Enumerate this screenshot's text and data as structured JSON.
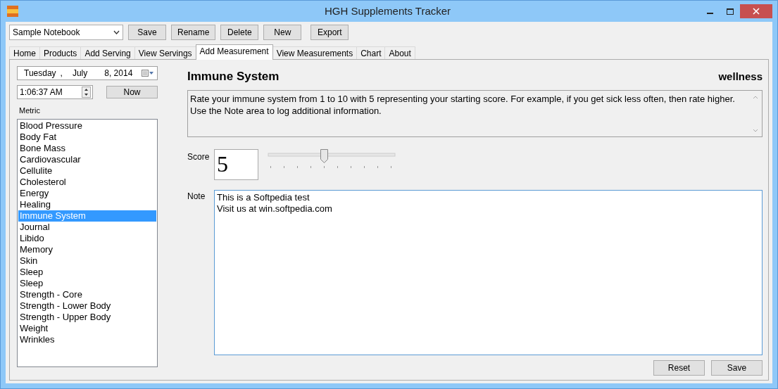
{
  "window": {
    "title": "HGH Supplements Tracker"
  },
  "notebook": {
    "value": "Sample Notebook"
  },
  "toolbar": [
    "Save",
    "Rename",
    "Delete",
    "New",
    "Export"
  ],
  "tabs": [
    {
      "label": "Home",
      "selected": false
    },
    {
      "label": "Products",
      "selected": false
    },
    {
      "label": "Add Serving",
      "selected": false
    },
    {
      "label": "View Servings",
      "selected": false
    },
    {
      "label": "Add Measurement",
      "selected": true
    },
    {
      "label": "View Measurements",
      "selected": false
    },
    {
      "label": "Chart",
      "selected": false
    },
    {
      "label": "About",
      "selected": false
    }
  ],
  "date": {
    "weekday": "Tuesday",
    "sep": ",",
    "month": "July",
    "day_year": "8, 2014"
  },
  "time": {
    "value": "1:06:37 AM"
  },
  "now_button": "Now",
  "metric_label": "Metric",
  "metrics": [
    {
      "label": "Blood Pressure",
      "selected": false
    },
    {
      "label": "Body Fat",
      "selected": false
    },
    {
      "label": "Bone Mass",
      "selected": false
    },
    {
      "label": "Cardiovascular",
      "selected": false
    },
    {
      "label": "Cellulite",
      "selected": false
    },
    {
      "label": "Cholesterol",
      "selected": false
    },
    {
      "label": "Energy",
      "selected": false
    },
    {
      "label": "Healing",
      "selected": false
    },
    {
      "label": "Immune System",
      "selected": true
    },
    {
      "label": "Journal",
      "selected": false
    },
    {
      "label": "Libido",
      "selected": false
    },
    {
      "label": "Memory",
      "selected": false
    },
    {
      "label": "Skin",
      "selected": false
    },
    {
      "label": "Sleep",
      "selected": false
    },
    {
      "label": "Sleep",
      "selected": false
    },
    {
      "label": "Strength - Core",
      "selected": false
    },
    {
      "label": "Strength - Lower Body",
      "selected": false
    },
    {
      "label": "Strength - Upper Body",
      "selected": false
    },
    {
      "label": "Weight",
      "selected": false
    },
    {
      "label": "Wrinkles",
      "selected": false
    }
  ],
  "heading": "Immune System",
  "category": "wellness",
  "description": [
    "Rate your immune system from 1 to 10 with 5 representing your starting score. For example, if you get sick less often, then rate higher.",
    "Use the Note area to log additional information."
  ],
  "score": {
    "label": "Score",
    "value": "5",
    "level": 0.444
  },
  "note": {
    "label": "Note",
    "lines": [
      "This is a Softpedia test",
      "Visit us at win.softpedia.com"
    ]
  },
  "footer": [
    "Reset",
    "Save"
  ]
}
